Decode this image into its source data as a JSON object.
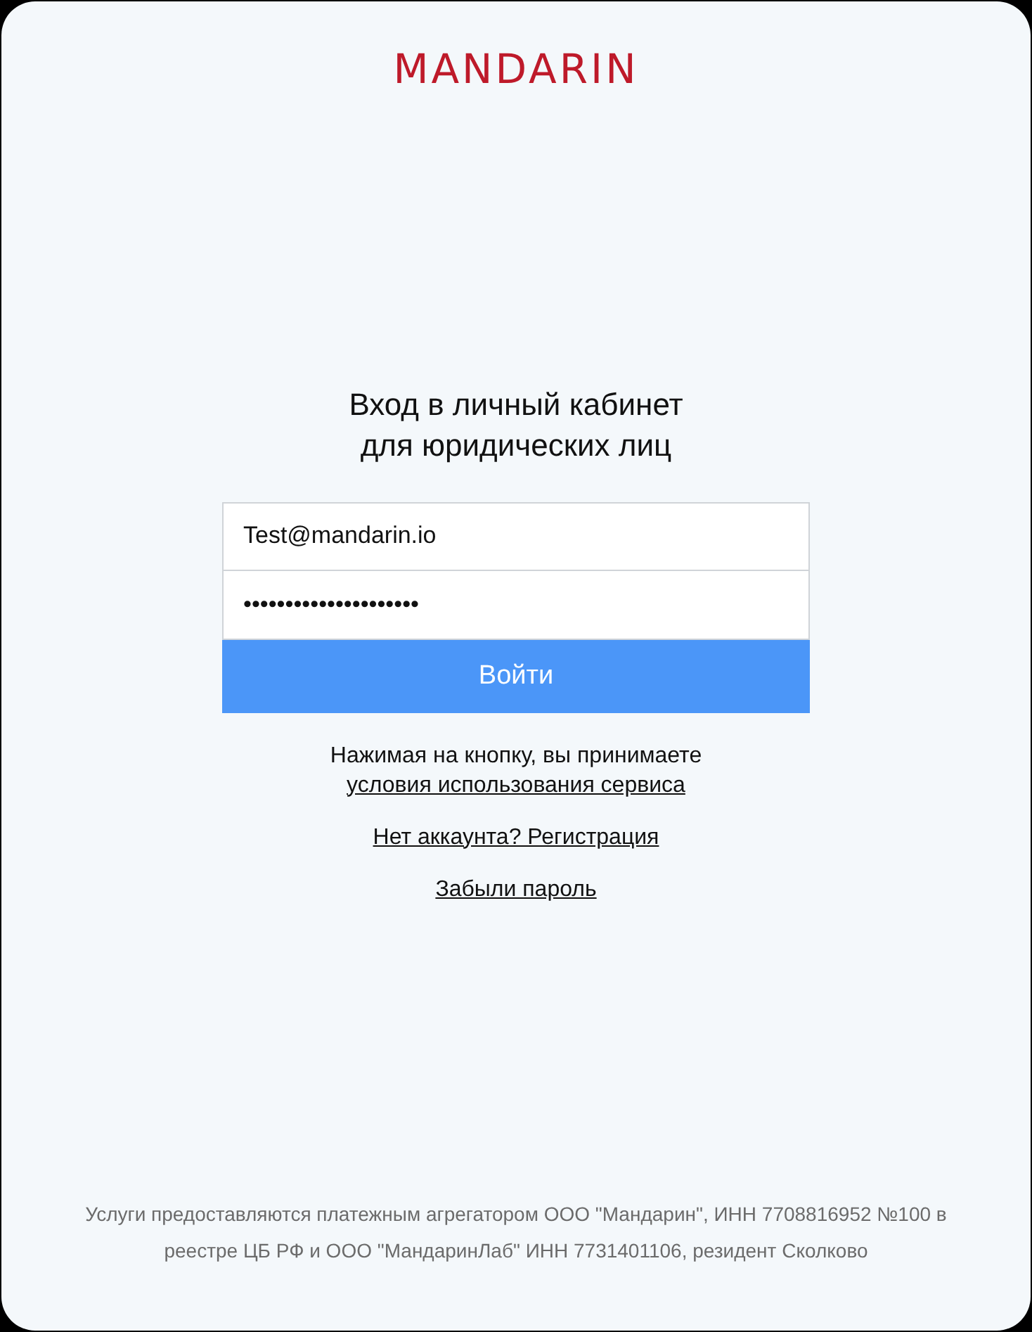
{
  "logo": "MANDARIN",
  "heading": [
    "Вход в личный кабинет",
    "для юридических лиц"
  ],
  "form": {
    "email": {
      "value": "Test@mandarin.io"
    },
    "password": {
      "value": "•••••••••••••••••••••"
    },
    "submit": "Войти"
  },
  "terms": {
    "text": "Нажимая на кнопку, вы принимаете",
    "link": "условия использования сервиса"
  },
  "links": [
    "Нет аккаунта? Регистрация",
    "Забыли пароль"
  ],
  "footer": [
    "Услуги предоставляются платежным агрегатором ООО \"Мандарин\", ИНН 7708816952 №100 в",
    "реестре ЦБ РФ и ООО \"МандаринЛаб\" ИНН 7731401106, резидент Сколково"
  ]
}
